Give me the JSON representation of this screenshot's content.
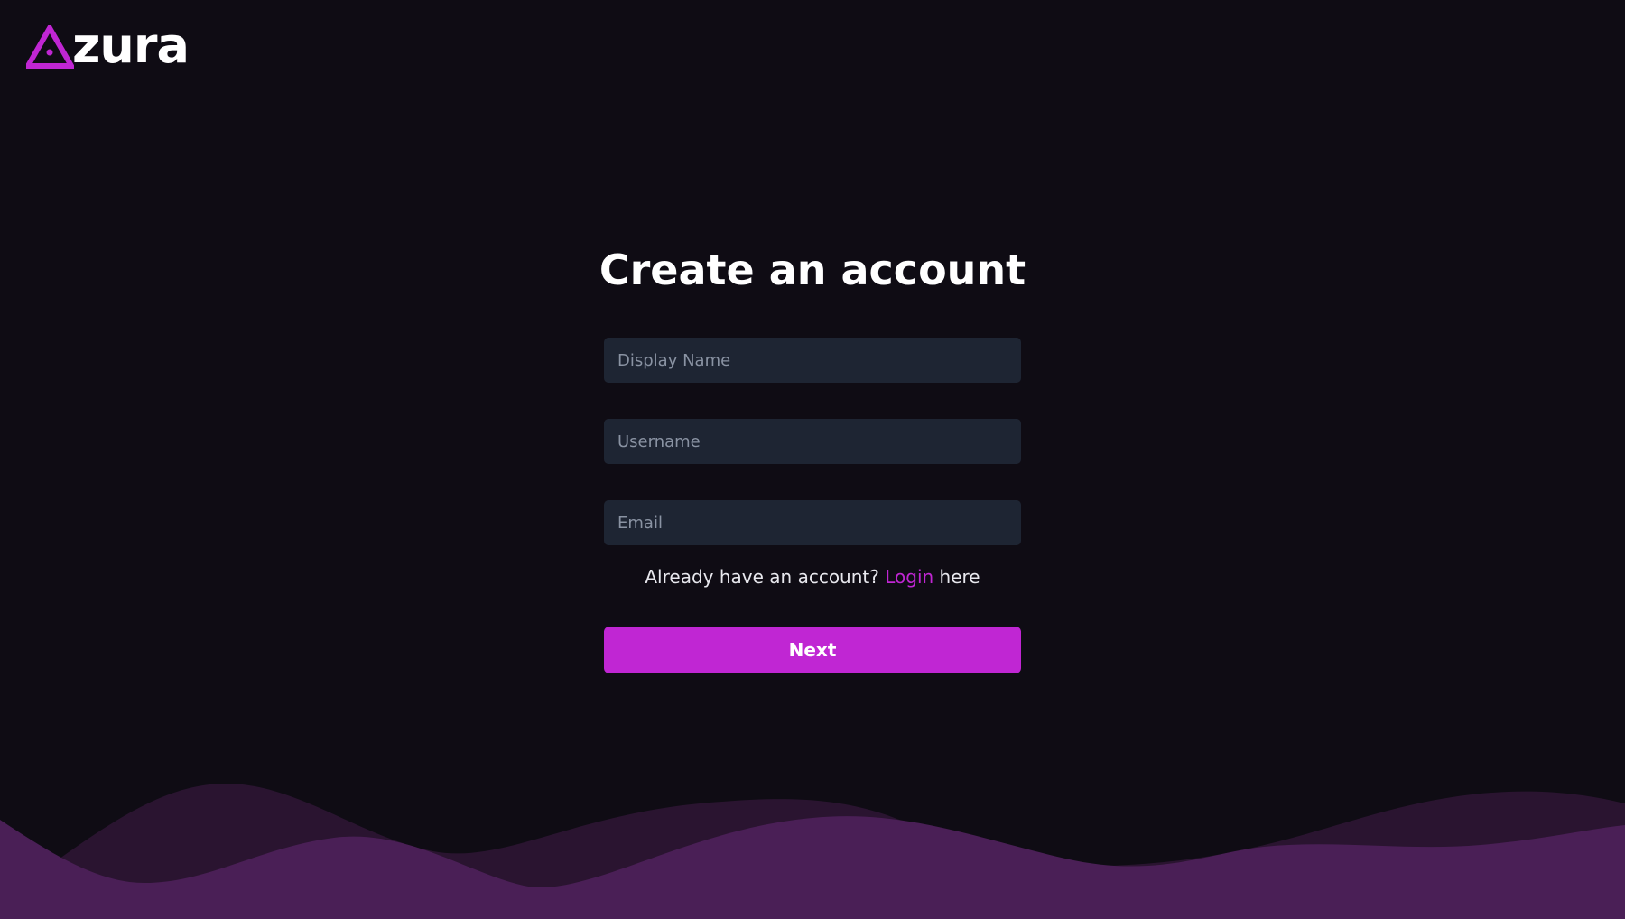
{
  "brand": {
    "name": "zura",
    "accent": "#c026d3",
    "logo_icon": "triangle-a-icon"
  },
  "form": {
    "title": "Create an account",
    "fields": {
      "display_name": {
        "placeholder": "Display Name",
        "value": ""
      },
      "username": {
        "placeholder": "Username",
        "value": ""
      },
      "email": {
        "placeholder": "Email",
        "value": ""
      }
    },
    "login_prompt": {
      "prefix": "Already have an account?",
      "link": "Login",
      "suffix": "here"
    },
    "next_label": "Next"
  },
  "colors": {
    "background": "#0f0c14",
    "input_background": "#1e2533",
    "wave_dark": "#2a1430",
    "wave_light": "#4a1f56"
  }
}
